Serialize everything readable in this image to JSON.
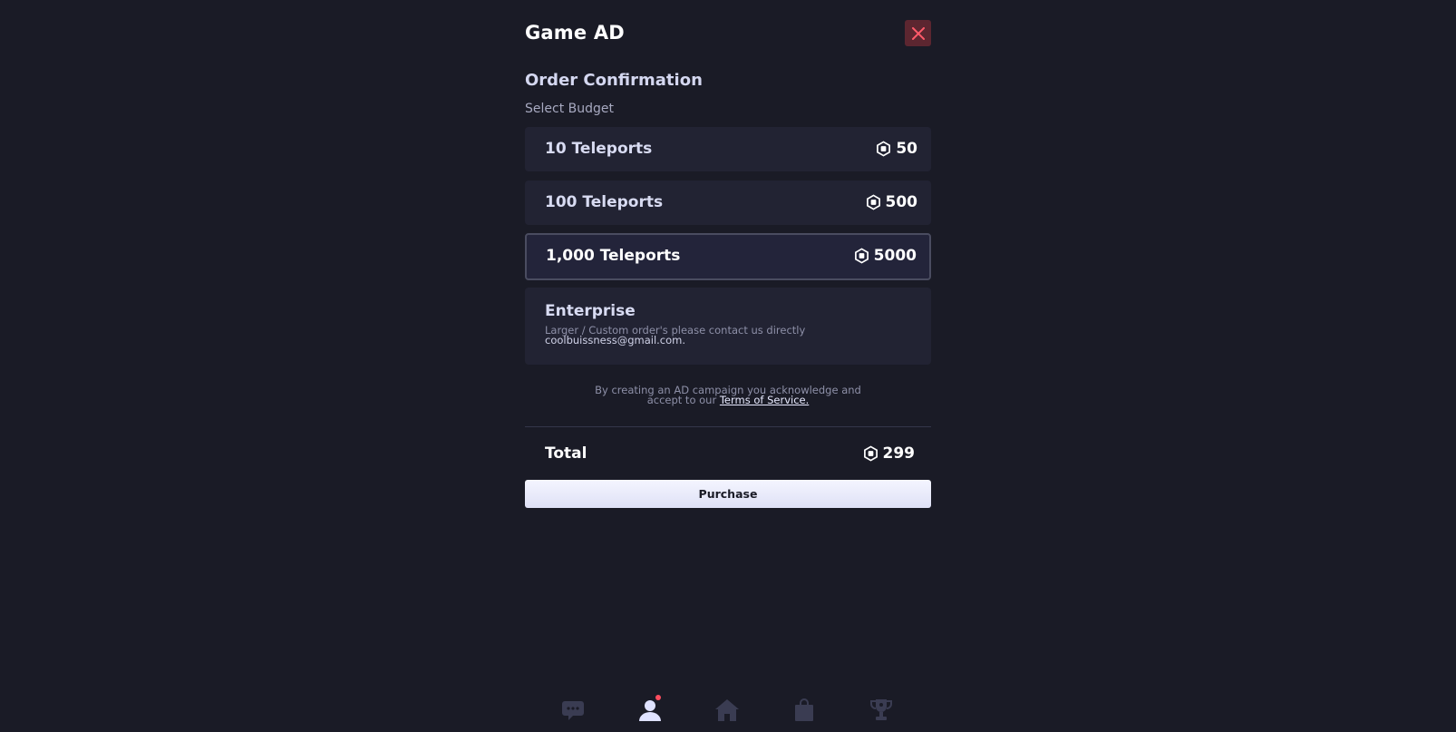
{
  "modal": {
    "title": "Game AD",
    "close_icon": "close-icon",
    "subtitle": "Order Confirmation",
    "budget_label": "Select Budget"
  },
  "options": [
    {
      "label": "10 Teleports",
      "price": "50",
      "selected": false
    },
    {
      "label": "100 Teleports",
      "price": "500",
      "selected": false
    },
    {
      "label": "1,000 Teleports",
      "price": "5000",
      "selected": true
    }
  ],
  "enterprise": {
    "title": "Enterprise",
    "description": "Larger / Custom order's please contact us directly",
    "email": "coolbuissness@gmail.com."
  },
  "terms": {
    "line1": "By creating an AD campaign you acknowledge and",
    "line2_prefix": "accept to our",
    "link": "Terms of Service."
  },
  "total": {
    "label": "Total",
    "value": "299"
  },
  "purchase_label": "Purchase",
  "currency_icon": "robux-icon",
  "colors": {
    "background": "#1a1b26",
    "card": "#222333",
    "close_bg": "#5c2630",
    "close_x": "#ff5a6a",
    "notification": "#ff4d5e"
  },
  "nav": [
    {
      "icon": "chat-icon",
      "active": false
    },
    {
      "icon": "profile-icon",
      "active": true,
      "notification": true
    },
    {
      "icon": "home-icon",
      "active": false
    },
    {
      "icon": "shop-bag-icon",
      "active": false
    },
    {
      "icon": "trophy-icon",
      "active": false
    }
  ]
}
